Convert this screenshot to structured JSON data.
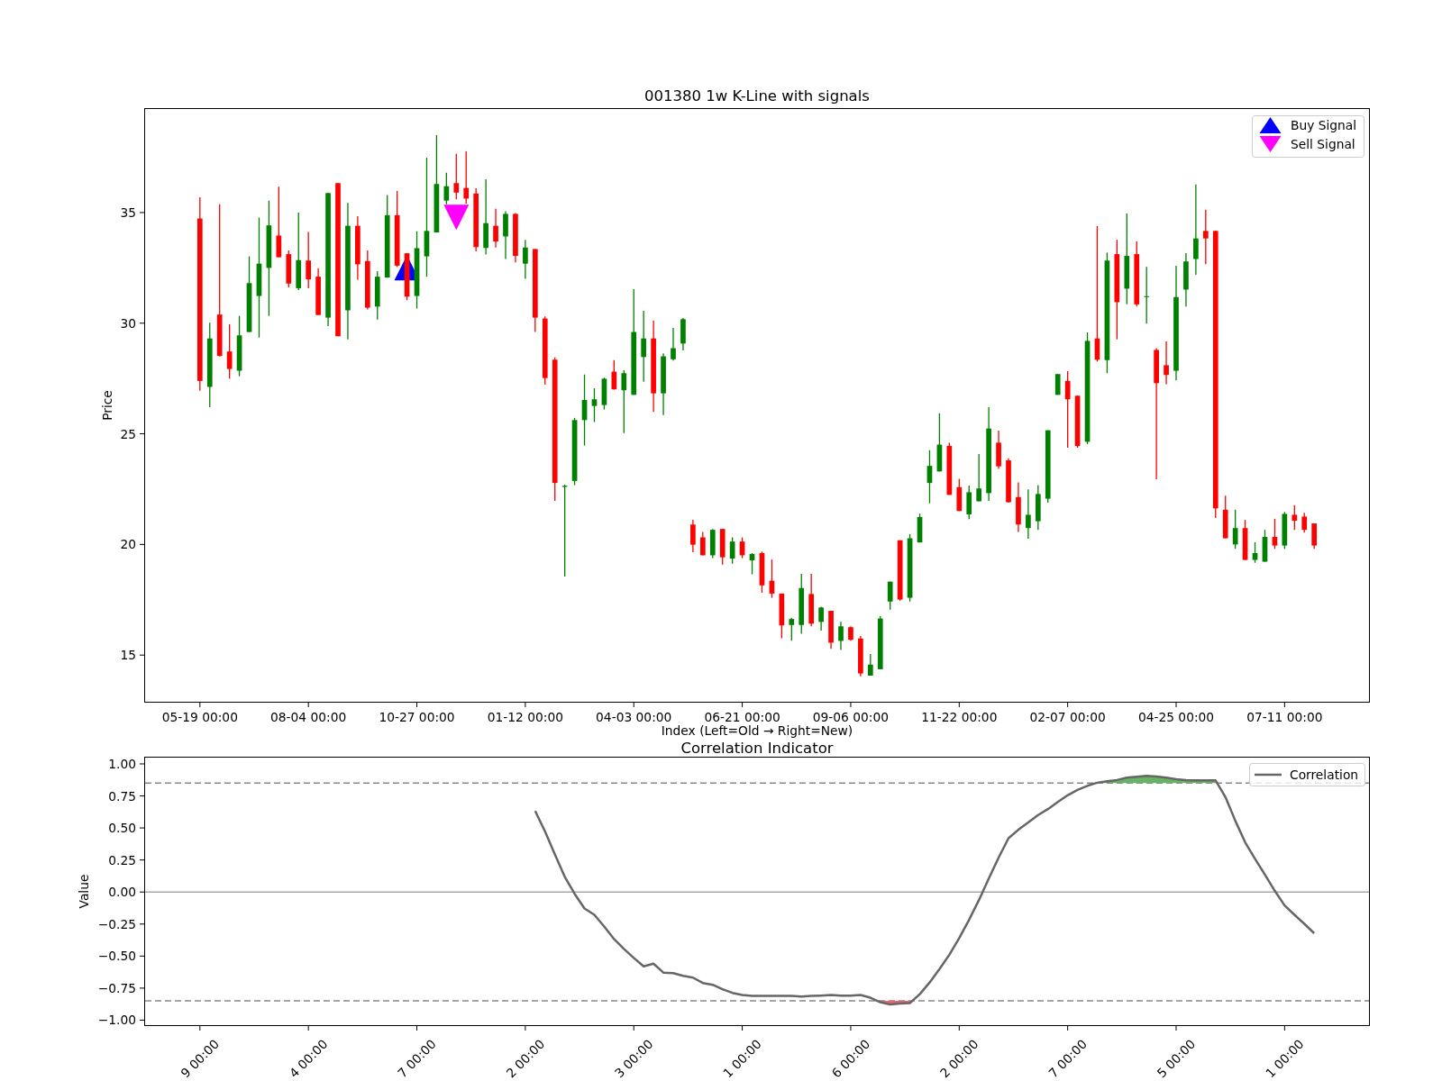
{
  "price_panel": {
    "chart_data": {
      "type": "candlestick",
      "title": "001380 1w K-Line with signals",
      "xlabel": "Index (Left=Old → Right=New)",
      "ylabel": "Price",
      "categories": [
        "05-19 00:00",
        null,
        null,
        null,
        null,
        null,
        null,
        null,
        null,
        null,
        null,
        "08-04 00:00",
        null,
        null,
        null,
        null,
        null,
        null,
        null,
        null,
        null,
        null,
        "10-27 00:00",
        null,
        null,
        null,
        null,
        null,
        null,
        null,
        null,
        null,
        null,
        "01-12 00:00",
        null,
        null,
        null,
        null,
        null,
        null,
        null,
        null,
        null,
        null,
        "04-03 00:00",
        null,
        null,
        null,
        null,
        null,
        null,
        null,
        null,
        null,
        null,
        "06-21 00:00",
        null,
        null,
        null,
        null,
        null,
        null,
        null,
        null,
        null,
        null,
        "09-06 00:00",
        null,
        null,
        null,
        null,
        null,
        null,
        null,
        null,
        null,
        null,
        "11-22 00:00",
        null,
        null,
        null,
        null,
        null,
        null,
        null,
        null,
        null,
        null,
        "02-07 00:00",
        null,
        null,
        null,
        null,
        null,
        null,
        null,
        null,
        null,
        null,
        "04-25 00:00",
        null,
        null,
        null,
        null,
        null,
        null,
        null,
        null,
        null,
        null,
        "07-11 00:00",
        null,
        null,
        null
      ],
      "ohlc": [
        [
          34.73,
          35.69,
          26.95,
          27.39
        ],
        [
          27.12,
          30.02,
          26.2,
          29.31
        ],
        [
          30.39,
          35.37,
          28.49,
          28.52
        ],
        [
          28.72,
          29.95,
          27.49,
          27.93
        ],
        [
          27.85,
          30.33,
          27.6,
          29.45
        ],
        [
          29.6,
          33.02,
          29.6,
          31.81
        ],
        [
          31.23,
          34.77,
          29.35,
          32.69
        ],
        [
          32.5,
          35.54,
          30.33,
          34.42
        ],
        [
          33.96,
          36.17,
          32.98,
          32.98
        ],
        [
          33.12,
          33.29,
          31.62,
          31.79
        ],
        [
          31.58,
          35.0,
          31.5,
          32.85
        ],
        [
          32.83,
          34.12,
          31.58,
          31.98
        ],
        [
          32.1,
          32.48,
          30.37,
          30.37
        ],
        [
          30.25,
          35.88,
          29.87,
          35.88
        ],
        [
          36.33,
          36.33,
          29.41,
          29.41
        ],
        [
          30.58,
          35.44,
          29.27,
          34.4
        ],
        [
          34.4,
          34.83,
          31.96,
          32.66
        ],
        [
          32.81,
          33.29,
          30.62,
          30.7
        ],
        [
          30.75,
          32.35,
          30.16,
          32.1
        ],
        [
          32.06,
          35.79,
          32.06,
          34.88
        ],
        [
          34.88,
          35.98,
          32.54,
          32.6
        ],
        [
          33.16,
          33.16,
          31.04,
          31.2
        ],
        [
          31.23,
          34.15,
          30.66,
          33.39
        ],
        [
          33.02,
          37.48,
          32.1,
          34.17
        ],
        [
          34.1,
          38.5,
          34.1,
          36.29
        ],
        [
          35.54,
          36.8,
          35.37,
          36.19
        ],
        [
          36.33,
          37.65,
          35.6,
          35.9
        ],
        [
          36.11,
          37.77,
          35.4,
          35.63
        ],
        [
          35.86,
          36.1,
          33.25,
          33.44
        ],
        [
          33.4,
          36.5,
          33.1,
          34.52
        ],
        [
          34.4,
          35.17,
          33.42,
          33.69
        ],
        [
          33.92,
          35.06,
          32.9,
          34.94
        ],
        [
          34.94,
          34.98,
          32.75,
          33.04
        ],
        [
          32.69,
          33.77,
          32.0,
          33.42
        ],
        [
          33.35,
          33.35,
          29.6,
          30.25
        ],
        [
          30.21,
          30.31,
          27.22,
          27.52
        ],
        [
          28.35,
          28.45,
          21.97,
          22.78
        ],
        [
          22.6,
          22.7,
          18.55,
          22.65
        ],
        [
          22.87,
          25.72,
          22.68,
          25.62
        ],
        [
          25.62,
          27.68,
          24.47,
          26.53
        ],
        [
          26.26,
          27.06,
          25.53,
          26.56
        ],
        [
          26.3,
          27.54,
          26.1,
          27.49
        ],
        [
          27.81,
          28.33,
          27.0,
          27.01
        ],
        [
          26.97,
          27.87,
          25.03,
          27.74
        ],
        [
          26.76,
          31.54,
          26.76,
          29.6
        ],
        [
          28.47,
          30.56,
          27.35,
          29.31
        ],
        [
          29.31,
          30.12,
          25.99,
          26.83
        ],
        [
          26.83,
          28.64,
          25.85,
          28.5
        ],
        [
          28.37,
          29.79,
          28.31,
          28.87
        ],
        [
          29.08,
          30.23,
          28.77,
          30.18
        ],
        [
          20.9,
          21.11,
          19.65,
          19.99
        ],
        [
          20.32,
          20.57,
          19.51,
          19.51
        ],
        [
          19.51,
          20.7,
          19.38,
          20.66
        ],
        [
          20.7,
          20.7,
          19.09,
          19.42
        ],
        [
          19.36,
          20.32,
          19.13,
          20.13
        ],
        [
          20.13,
          20.32,
          19.38,
          19.51
        ],
        [
          19.28,
          19.61,
          18.65,
          19.57
        ],
        [
          19.61,
          19.68,
          17.82,
          18.15
        ],
        [
          18.36,
          19.32,
          17.59,
          17.78
        ],
        [
          17.78,
          17.78,
          15.76,
          16.34
        ],
        [
          16.36,
          16.69,
          15.65,
          16.63
        ],
        [
          16.36,
          18.67,
          15.96,
          18.03
        ],
        [
          17.76,
          18.67,
          16.3,
          16.42
        ],
        [
          16.5,
          17.19,
          16.11,
          17.15
        ],
        [
          17.0,
          17.0,
          15.28,
          15.56
        ],
        [
          15.64,
          16.5,
          15.23,
          16.3
        ],
        [
          16.26,
          16.3,
          15.65,
          15.69
        ],
        [
          15.75,
          15.86,
          14.04,
          14.17
        ],
        [
          14.07,
          15.05,
          14.07,
          14.57
        ],
        [
          14.36,
          16.76,
          14.36,
          16.65
        ],
        [
          17.42,
          18.32,
          17.05,
          18.32
        ],
        [
          20.19,
          20.19,
          17.46,
          17.51
        ],
        [
          17.59,
          20.47,
          17.42,
          20.28
        ],
        [
          20.09,
          21.39,
          20.09,
          21.24
        ],
        [
          22.78,
          24.26,
          21.86,
          23.55
        ],
        [
          23.3,
          25.93,
          23.3,
          24.51
        ],
        [
          24.45,
          24.6,
          22.24,
          22.24
        ],
        [
          22.59,
          22.97,
          21.51,
          21.51
        ],
        [
          21.36,
          22.66,
          21.15,
          22.36
        ],
        [
          21.95,
          24.09,
          21.95,
          22.53
        ],
        [
          22.32,
          26.2,
          21.97,
          25.24
        ],
        [
          24.6,
          25.14,
          23.41,
          23.53
        ],
        [
          23.8,
          23.89,
          21.89,
          21.91
        ],
        [
          22.14,
          22.8,
          20.57,
          20.9
        ],
        [
          20.74,
          22.49,
          20.26,
          21.34
        ],
        [
          21.05,
          22.68,
          20.66,
          22.28
        ],
        [
          22.07,
          25.16,
          21.89,
          25.16
        ],
        [
          26.76,
          27.7,
          26.76,
          27.7
        ],
        [
          27.39,
          27.83,
          24.37,
          26.56
        ],
        [
          26.72,
          26.72,
          24.37,
          24.45
        ],
        [
          24.64,
          29.58,
          24.53,
          29.2
        ],
        [
          29.31,
          34.39,
          28.27,
          28.35
        ],
        [
          28.33,
          33.19,
          27.74,
          32.83
        ],
        [
          33.12,
          33.77,
          29.27,
          30.95
        ],
        [
          31.56,
          34.96,
          30.85,
          33.04
        ],
        [
          33.12,
          33.69,
          30.75,
          30.85
        ],
        [
          31.2,
          32.54,
          29.98,
          31.22
        ],
        [
          28.79,
          28.87,
          22.95,
          27.29
        ],
        [
          28.1,
          29.18,
          27.24,
          27.66
        ],
        [
          27.85,
          32.6,
          27.41,
          31.18
        ],
        [
          31.52,
          33.17,
          30.75,
          32.79
        ],
        [
          32.9,
          36.27,
          32.19,
          33.83
        ],
        [
          34.17,
          35.13,
          32.67,
          33.83
        ],
        [
          34.17,
          34.17,
          21.2,
          21.63
        ],
        [
          21.57,
          22.2,
          20.28,
          20.28
        ],
        [
          20.0,
          21.57,
          19.8,
          20.74
        ],
        [
          20.74,
          21.11,
          19.3,
          19.3
        ],
        [
          19.3,
          20.1,
          19.17,
          19.61
        ],
        [
          19.22,
          20.66,
          19.22,
          20.34
        ],
        [
          20.34,
          21.16,
          19.8,
          19.95
        ],
        [
          19.95,
          21.47,
          19.8,
          21.38
        ],
        [
          21.34,
          21.78,
          20.66,
          21.07
        ],
        [
          21.26,
          21.43,
          20.53,
          20.66
        ],
        [
          20.95,
          20.95,
          19.8,
          19.95
        ]
      ],
      "ylim": [
        12.85,
        39.72
      ],
      "yticks": [
        15,
        20,
        25,
        30,
        35
      ]
    },
    "legend": [
      {
        "kind": "buy",
        "label": "Buy Signal",
        "color": "#0000ff"
      },
      {
        "kind": "sell",
        "label": "Sell Signal",
        "color": "#ff00ff"
      }
    ]
  },
  "correlation_panel": {
    "chart_data": {
      "type": "line",
      "title": "Correlation Indicator",
      "ylabel": "Value",
      "categories": [
        "9 00:00",
        null,
        null,
        null,
        null,
        null,
        null,
        null,
        null,
        null,
        null,
        "4 00:00",
        null,
        null,
        null,
        null,
        null,
        null,
        null,
        null,
        null,
        null,
        "7 00:00",
        null,
        null,
        null,
        null,
        null,
        null,
        null,
        null,
        null,
        null,
        "2 00:00",
        null,
        null,
        null,
        null,
        null,
        null,
        null,
        null,
        null,
        null,
        "3 00:00",
        null,
        null,
        null,
        null,
        null,
        null,
        null,
        null,
        null,
        null,
        "1 00:00",
        null,
        null,
        null,
        null,
        null,
        null,
        null,
        null,
        null,
        null,
        "6 00:00",
        null,
        null,
        null,
        null,
        null,
        null,
        null,
        null,
        null,
        null,
        "2 00:00",
        null,
        null,
        null,
        null,
        null,
        null,
        null,
        null,
        null,
        null,
        "7 00:00",
        null,
        null,
        null,
        null,
        null,
        null,
        null,
        null,
        null,
        null,
        "5 00:00",
        null,
        null,
        null,
        null,
        null,
        null,
        null,
        null,
        null,
        null,
        "1 00:00",
        null,
        null,
        null
      ],
      "series": [
        {
          "name": "Correlation",
          "color": "#666666",
          "values": [
            null,
            null,
            null,
            null,
            null,
            null,
            null,
            null,
            null,
            null,
            null,
            null,
            null,
            null,
            null,
            null,
            null,
            null,
            null,
            null,
            null,
            null,
            null,
            null,
            null,
            null,
            null,
            null,
            null,
            null,
            null,
            null,
            null,
            null,
            0.633,
            0.472,
            0.294,
            0.119,
            -0.014,
            -0.129,
            -0.178,
            -0.269,
            -0.367,
            -0.444,
            -0.514,
            -0.58,
            -0.559,
            -0.629,
            -0.633,
            -0.654,
            -0.668,
            -0.71,
            -0.724,
            -0.759,
            -0.787,
            -0.804,
            -0.811,
            -0.811,
            -0.811,
            -0.811,
            -0.811,
            -0.815,
            -0.811,
            -0.808,
            -0.804,
            -0.808,
            -0.808,
            -0.804,
            -0.825,
            -0.86,
            -0.878,
            -0.871,
            -0.867,
            -0.797,
            -0.706,
            -0.601,
            -0.49,
            -0.36,
            -0.217,
            -0.063,
            0.105,
            0.269,
            0.42,
            0.486,
            0.542,
            0.601,
            0.647,
            0.703,
            0.755,
            0.797,
            0.829,
            0.853,
            0.864,
            0.874,
            0.892,
            0.899,
            0.906,
            0.902,
            0.892,
            0.881,
            0.874,
            0.871,
            0.871,
            0.871,
            0.741,
            0.556,
            0.388,
            0.259,
            0.136,
            0.01,
            -0.105,
            -0.178,
            -0.248,
            -0.322
          ]
        }
      ],
      "ylim": [
        -1.046,
        1.056
      ],
      "yticks": [
        {
          "value": 1,
          "label": "1.00"
        },
        {
          "value": 0.75,
          "label": "0.75"
        },
        {
          "value": 0.5,
          "label": "0.50"
        },
        {
          "value": 0.25,
          "label": "0.25"
        },
        {
          "value": 0,
          "label": "0.00"
        },
        {
          "value": -0.25,
          "label": "−0.25"
        },
        {
          "value": -0.5,
          "label": "−0.50"
        },
        {
          "value": -0.75,
          "label": "−0.75"
        },
        {
          "value": -1,
          "label": "−1.00"
        }
      ],
      "ref_lines": [
        {
          "axis": "y",
          "value": 0.85
        },
        {
          "axis": "y",
          "value": -0.85
        },
        {
          "axis": "y",
          "value": 0
        }
      ]
    }
  }
}
